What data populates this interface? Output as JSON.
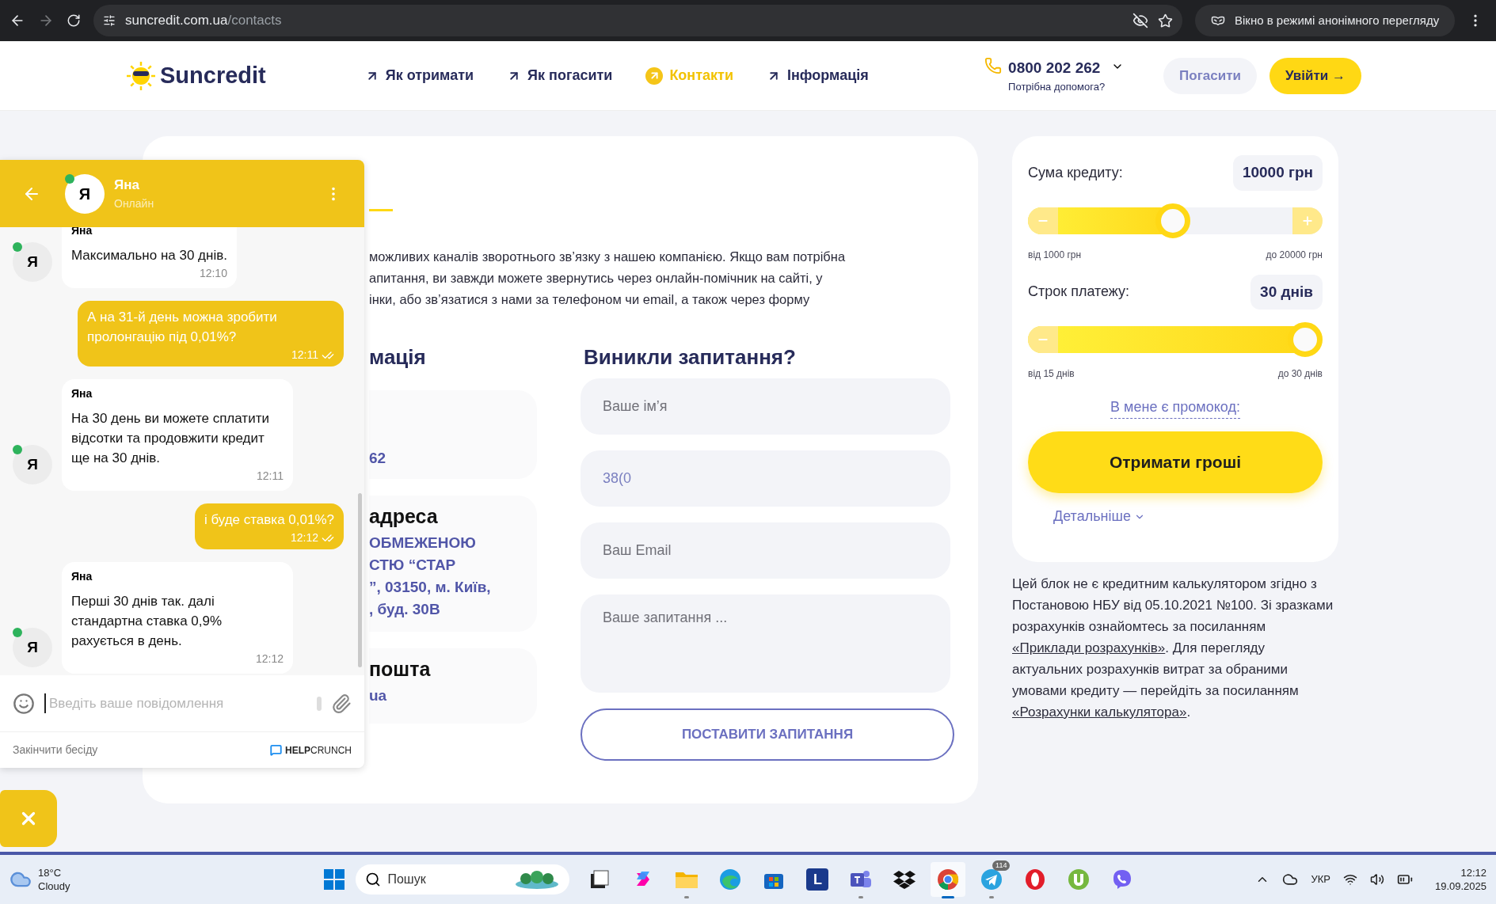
{
  "browser": {
    "url_host": "suncredit.com.ua",
    "url_path": "/contacts",
    "incognito_label": "Вікно в режимі анонімного перегляду"
  },
  "header": {
    "logo": "Suncredit",
    "nav": [
      {
        "label": "Як отримати",
        "selected": false
      },
      {
        "label": "Як погасити",
        "selected": false
      },
      {
        "label": "Контакти",
        "selected": true
      },
      {
        "label": "Інформація",
        "selected": false
      }
    ],
    "phone": "0800 202 262",
    "help": "Потрібна допомога?",
    "buttons": [
      {
        "label": "Погасити",
        "kind": "secondary"
      },
      {
        "label": "Увійти →",
        "kind": "primary"
      }
    ]
  },
  "contacts": {
    "intro_lines": [
      "можливих каналів зворотнього зв’язку з нашею компанією. Якщо вам потрібна",
      "апитання, ви завжди можете звернутись через онлайн-помічник на сайті, у",
      "інки, або зв’язатися з нами за телефоном чи email, а також через форму"
    ],
    "info_heading": "мація",
    "info_cards": [
      {
        "lines": [
          "62"
        ]
      },
      {
        "title": "адреса",
        "lines": [
          "ОБМЕЖЕНОЮ",
          "СТЮ “СТАР",
          "”, 03150, м. Київ,",
          ", буд. 30В"
        ]
      },
      {
        "title": "пошта",
        "lines": [
          "ua"
        ]
      }
    ],
    "form_heading": "Виникли запитання?",
    "fields": [
      {
        "kind": "input",
        "placeholder": "Ваше ім’я"
      },
      {
        "kind": "input",
        "value": "38(0"
      },
      {
        "kind": "input",
        "placeholder": "Ваш Email"
      },
      {
        "kind": "textarea",
        "placeholder": "Ваше запитання ..."
      }
    ],
    "submit": "ПОСТАВИТИ ЗАПИТАННЯ"
  },
  "calculator": {
    "sliders": [
      {
        "label": "Сума кредиту:",
        "value": "10000 грн",
        "level": 0.49,
        "min": "від 1000 грн",
        "max": "до 20000 грн"
      },
      {
        "label": "Строк платежу:",
        "value": "30 днів",
        "level": 1,
        "min": "від 15 днів",
        "max": "до 30 днів"
      }
    ],
    "promo": "В мене є промокод:",
    "cta": "Отримати гроші",
    "details": "Детальніше"
  },
  "disclaimer": [
    {
      "kind": "text",
      "text": "Цей блок не є кредитним калькулятором згідно з Постановою НБУ від 05.10.2021 №100. Зі зразками розрахунків ознайомтесь за посиланням "
    },
    {
      "kind": "link",
      "text": "«Приклади розрахунків»"
    },
    {
      "kind": "text",
      "text": ". Для перегляду актуальних розрахунків витрат за обраними умовами кредиту — перейдіть за посиланням "
    },
    {
      "kind": "link",
      "text": "«Розрахунки калькулятора»"
    },
    {
      "kind": "text",
      "text": "."
    }
  ],
  "chat": {
    "agent": "Яна",
    "avatar": "Я",
    "status": "Онлайн",
    "online": true,
    "messages": [
      {
        "kind": "agent",
        "avatar": "Я",
        "online": true,
        "sender": "Яна",
        "text": "Максимально на 30 днів.",
        "time": "12:10"
      },
      {
        "kind": "user",
        "text": "А на 31-й день можна зробити пролонгацію під 0,01%?",
        "time": "12:11",
        "read": true
      },
      {
        "kind": "agent",
        "avatar": "Я",
        "online": true,
        "sender": "Яна",
        "text": "На 30 день ви можете сплатити відсотки та продовжити кредит ще на 30 днів.",
        "time": "12:11"
      },
      {
        "kind": "user",
        "text": "і буде ставка 0,01%?",
        "time": "12:12",
        "read": true
      },
      {
        "kind": "agent",
        "avatar": "Я",
        "online": true,
        "sender": "Яна",
        "text": "Перші 30 днів так. далі стандартна ставка 0,9% рахується в день.",
        "time": "12:12"
      }
    ],
    "input_placeholder": "Введіть ваше повідомлення",
    "end": "Закінчити бесіду",
    "brand": "**HELP**CRUNCH"
  },
  "taskbar": {
    "temp": "18°C",
    "weather": "Cloudy",
    "search": "Пошук",
    "apps": [
      {
        "kind": "taskview"
      },
      {
        "kind": "copilot"
      },
      {
        "kind": "explorer",
        "running": true
      },
      {
        "kind": "edge"
      },
      {
        "kind": "store"
      },
      {
        "kind": "letter",
        "label": "L"
      },
      {
        "kind": "teams",
        "running": true
      },
      {
        "kind": "dropbox"
      },
      {
        "kind": "chrome",
        "running": true,
        "active": true
      },
      {
        "kind": "telegram",
        "badge": "114",
        "running": true
      },
      {
        "kind": "opera"
      },
      {
        "kind": "utorrent"
      },
      {
        "kind": "viber"
      }
    ],
    "lang": "УКР",
    "time": "12:12",
    "date": "19.09.2025"
  }
}
